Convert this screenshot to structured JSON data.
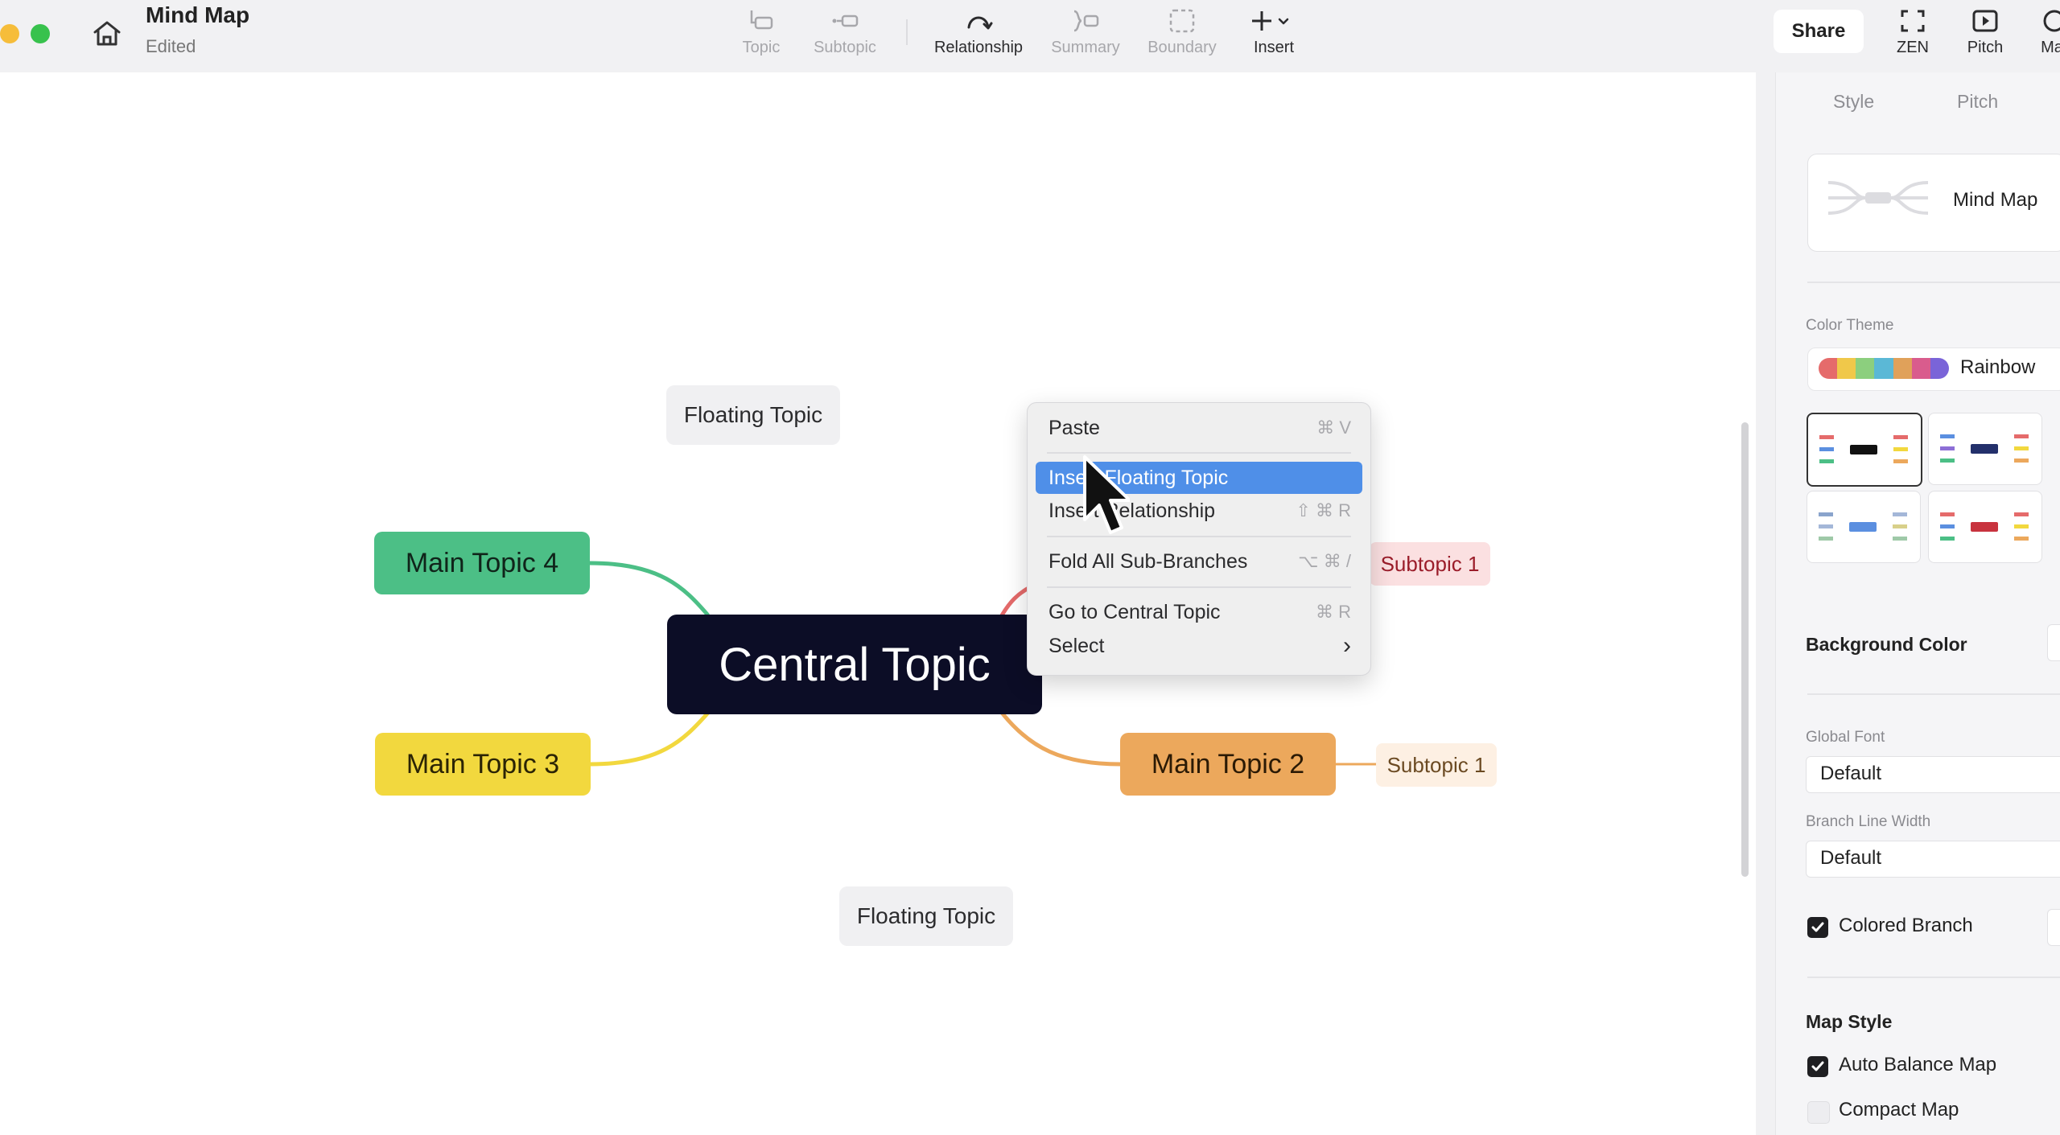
{
  "window": {
    "title": "Mind Map",
    "status": "Edited"
  },
  "toolbar": {
    "topic": "Topic",
    "subtopic": "Subtopic",
    "relationship": "Relationship",
    "summary": "Summary",
    "boundary": "Boundary",
    "insert": "Insert",
    "share": "Share",
    "zen": "ZEN",
    "pitch": "Pitch",
    "more": "Ma"
  },
  "map": {
    "central": "Central Topic",
    "main_topic_4": "Main Topic 4",
    "main_topic_3": "Main Topic 3",
    "main_topic_2": "Main Topic 2",
    "subtopic_upper": "Subtopic 1",
    "subtopic_lower": "Subtopic 1",
    "floating_top": "Floating Topic",
    "floating_bottom": "Floating Topic",
    "colors": {
      "central": "#0c0d26",
      "topic4": "#4cbf86",
      "topic3": "#f2d83e",
      "topic2": "#eca85c",
      "topic1_line": "#e46a6a"
    }
  },
  "context_menu": {
    "paste": "Paste",
    "paste_shortcut": "⌘ V",
    "insert_floating": "Insert Floating Topic",
    "insert_relationship": "Insert Relationship",
    "insert_relationship_shortcut": "⇧ ⌘ R",
    "fold_all": "Fold All Sub-Branches",
    "fold_all_shortcut": "⌥ ⌘ /",
    "go_central": "Go to Central Topic",
    "go_central_shortcut": "⌘ R",
    "select": "Select",
    "select_arrow": "›"
  },
  "panel": {
    "tabs": [
      "Style",
      "Pitch"
    ],
    "structure_name": "Mind Map",
    "color_theme_label": "Color Theme",
    "color_theme_value": "Rainbow",
    "background_color_label": "Background Color",
    "global_font_label": "Global Font",
    "global_font_value": "Default",
    "branch_line_width_label": "Branch Line Width",
    "branch_line_width_value": "Default",
    "colored_branch_label": "Colored Branch",
    "colored_branch_checked": true,
    "map_style_label": "Map Style",
    "auto_balance_label": "Auto Balance Map",
    "auto_balance_checked": true,
    "compact_map_label": "Compact Map",
    "compact_map_checked": false
  }
}
